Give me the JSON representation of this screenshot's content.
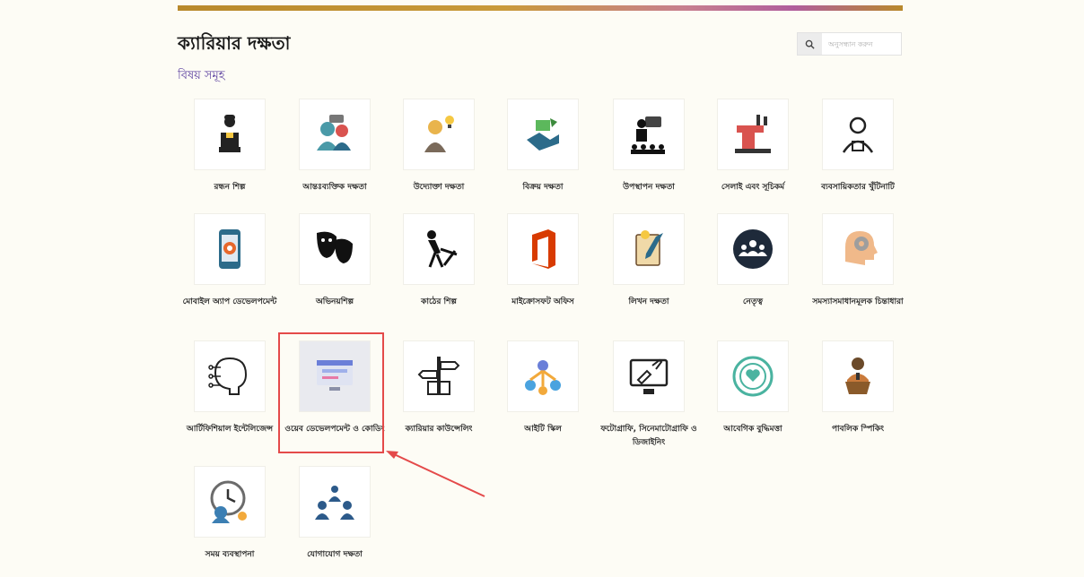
{
  "header": {
    "title": "ক্যারিয়ার দক্ষতা",
    "subtitle": "বিষয় সমূহ",
    "search_placeholder": "অনুসন্ধান করুন"
  },
  "tiles": [
    {
      "label": "রন্ধন শিল্প",
      "icon": "chef-icon"
    },
    {
      "label": "আন্তঃব্যক্তিক দক্ষতা",
      "icon": "people-talk-icon"
    },
    {
      "label": "উদ্যোক্তা দক্ষতা",
      "icon": "entrepreneur-icon"
    },
    {
      "label": "বিক্রয় দক্ষতা",
      "icon": "sales-handshake-icon"
    },
    {
      "label": "উপস্থাপন দক্ষতা",
      "icon": "presentation-icon"
    },
    {
      "label": "সেলাই এবং সূচিকর্ম",
      "icon": "sewing-machine-icon"
    },
    {
      "label": "ব্যবসায়িকতার খুঁটিনাটি",
      "icon": "business-person-icon"
    },
    {
      "label": "মোবাইল অ্যাপ ডেভেলপমেন্ট",
      "icon": "mobile-app-icon"
    },
    {
      "label": "অভিনয়শিল্প",
      "icon": "theater-masks-icon"
    },
    {
      "label": "কাঠের শিল্প",
      "icon": "woodwork-icon"
    },
    {
      "label": "মাইক্রোসফট অফিস",
      "icon": "office-logo-icon"
    },
    {
      "label": "লিখন দক্ষতা",
      "icon": "writing-icon"
    },
    {
      "label": "নেতৃত্ব",
      "icon": "leadership-icon"
    },
    {
      "label": "সমস্যাসমাধানমূলক চিন্তাধারা",
      "icon": "problem-solving-head-icon"
    },
    {
      "label": "আর্টিফিশিয়াল ইন্টেলিজেন্স",
      "icon": "ai-brain-icon"
    },
    {
      "label": "ওয়েব ডেভেলপমেন্ট ও কোডিং",
      "icon": "web-dev-icon"
    },
    {
      "label": "ক্যারিয়ার কাউন্সেলিং",
      "icon": "career-signpost-icon"
    },
    {
      "label": "আইটি স্কিল",
      "icon": "it-network-icon"
    },
    {
      "label": "ফটোগ্রাফি, সিনেমাটোগ্রাফি ও ডিজাইনিং",
      "icon": "design-monitor-icon"
    },
    {
      "label": "আবেগিক বুদ্ধিমত্তা",
      "icon": "emotional-head-icon"
    },
    {
      "label": "পাবলিক স্পিকিং",
      "icon": "public-speaker-icon"
    },
    {
      "label": "সময় ব্যবস্থাপনা",
      "icon": "time-management-icon"
    },
    {
      "label": "যোগাযোগ দক্ষতা",
      "icon": "communication-icon"
    }
  ],
  "highlighted_tile": "ওয়েব ডেভেলপমেন্ট ও কোডিং"
}
